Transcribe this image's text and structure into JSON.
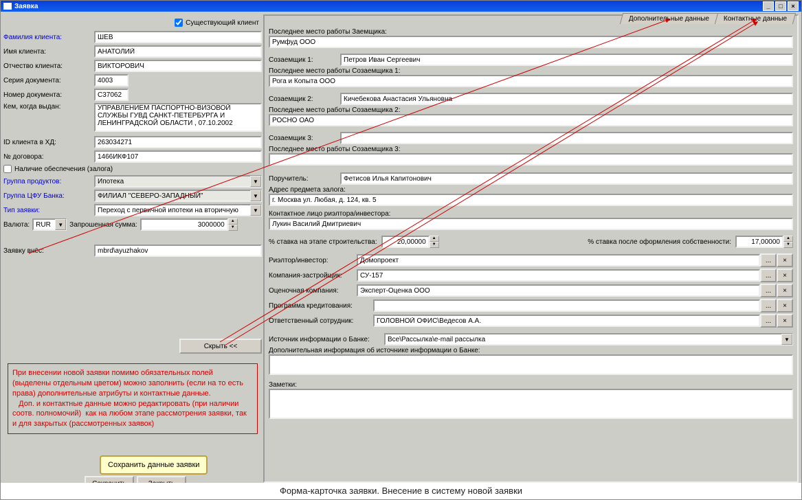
{
  "window": {
    "title": "Заявка"
  },
  "caption": "Форма-карточка заявки. Внесение в систему новой заявки",
  "existing_client": {
    "label": "Существующий клиент",
    "checked": true
  },
  "left": {
    "surname_lbl": "Фамилия клиента:",
    "surname": "ШЕВ",
    "name_lbl": "Имя клиента:",
    "name": "АНАТОЛИЙ",
    "patronymic_lbl": "Отчество клиента:",
    "patronymic": "ВИКТОРОВИЧ",
    "doc_series_lbl": "Серия документа:",
    "doc_series": "4003",
    "doc_number_lbl": "Номер документа:",
    "doc_number": "С37062",
    "issued_lbl": "Кем, когда выдан:",
    "issued": "УПРАВЛЕНИЕМ ПАСПОРТНО-ВИЗОВОЙ СЛУЖБЫ ГУВД САНКТ-ПЕТЕРБУРГА И ЛЕНИНГРАДСКОЙ ОБЛАСТИ , 07.10.2002",
    "client_id_lbl": "ID клиента в ХД:",
    "client_id": "263034271",
    "contract_lbl": "№ договора:",
    "contract": "1466ИКФ107",
    "collateral_lbl": "Наличие обеспечения (залога)",
    "collateral_checked": false,
    "product_group_lbl": "Группа продуктов:",
    "product_group": "Ипотека",
    "cfu_group_lbl": "Группа ЦФУ Банка:",
    "cfu_group": "ФИЛИАЛ \"СЕВЕРО-ЗАПАДНЫЙ\"",
    "app_type_lbl": "Тип заявки:",
    "app_type": "Переход с первичной ипотеки на вторичную",
    "currency_lbl": "Валюта:",
    "currency": "RUR",
    "req_sum_lbl": "Запрошенная сумма:",
    "req_sum": "3000000",
    "creator_lbl": "Заявку внёс:",
    "creator": "mbrd\\ayuzhakov",
    "hide_btn": "Скрыть <<",
    "save_btn": "Сохранить",
    "close_btn": "Закрыть",
    "bubble": "Сохранить данные заявки"
  },
  "redbox": "При внесении новой заявки помимо обязательных полей (выделены отдельным цветом) можно заполнить (если на то есть права) дополнительные атрибуты и контактные данные.\n   Доп. и контактные данные можно редактировать (при наличии соотв. полномочий)  как на любом этапе рассмотрения заявки, так и для закрытых (рассмотренных заявок)",
  "tabs": {
    "additional": "Дополнительные данные",
    "contact": "Контактные данные"
  },
  "right": {
    "last_job_lbl": "Последнее место работы Заемщика:",
    "last_job": "Румфуд ООО",
    "cob1_lbl": "Созаемщик 1:",
    "cob1": "Петров Иван Сергеевич",
    "cob1_job_lbl": "Последнее место работы Созаемщика 1:",
    "cob1_job": "Рога и Копыта ООО",
    "cob2_lbl": "Созаемщик 2:",
    "cob2": "Кичебекова Анастасия Ульяновна",
    "cob2_job_lbl": "Последнее место работы Созаемщика 2:",
    "cob2_job": "РОСНО ОАО",
    "cob3_lbl": "Созаемщик 3:",
    "cob3": "",
    "cob3_job_lbl": "Последнее место работы Созаемщика 3:",
    "cob3_job": "",
    "guarantor_lbl": "Поручитель:",
    "guarantor": "Фетисов Илья Капитонович",
    "pledge_addr_lbl": "Адрес предмета залога:",
    "pledge_addr": "г. Москва ул. Любая, д. 124, кв. 5",
    "contact_person_lbl": "Контактное лицо риэлтора/инвестора:",
    "contact_person": "Лукин Василий Дмитриевич",
    "rate_build_lbl": "% ставка на этапе строительства:",
    "rate_build": "20,00000",
    "rate_own_lbl": "% ставка после оформления собственности:",
    "rate_own": "17,00000",
    "realtor_lbl": "Риэлтор/инвестор:",
    "realtor": "Домопроект",
    "dev_lbl": "Компания-застройщик:",
    "dev": "СУ-157",
    "valuer_lbl": "Оценочная компания:",
    "valuer": "Эксперт-Оценка ООО",
    "loan_prog_lbl": "Программа кредитования:",
    "loan_prog": "",
    "resp_lbl": "Ответственный сотрудник:",
    "resp": "ГОЛОВНОЙ ОФИС\\Ведесов А.А.",
    "src_lbl": "Источник информации о Банке:",
    "src": "Все\\Рассылка\\e-mail рассылка",
    "src_extra_lbl": "Дополнительная информация об источнике информации о Банке:",
    "notes_lbl": "Заметки:"
  }
}
